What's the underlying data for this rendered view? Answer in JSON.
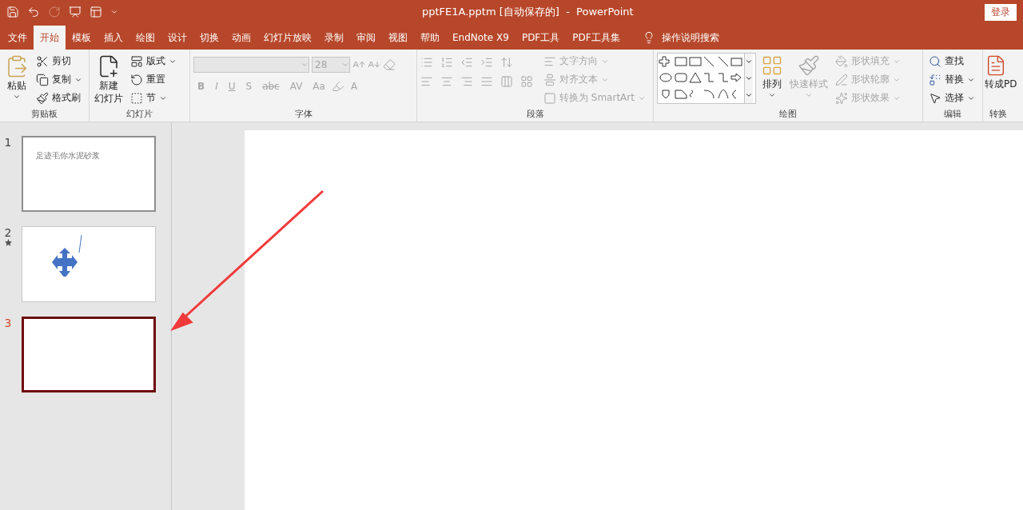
{
  "title_bar": {
    "title": "pptFE1A.pptm [自动保存的]  -  PowerPoint",
    "sign_in": "登录"
  },
  "tabs": [
    {
      "label": "文件",
      "selected": false
    },
    {
      "label": "开始",
      "selected": true
    },
    {
      "label": "模板",
      "selected": false
    },
    {
      "label": "插入",
      "selected": false
    },
    {
      "label": "绘图",
      "selected": false
    },
    {
      "label": "设计",
      "selected": false
    },
    {
      "label": "切换",
      "selected": false
    },
    {
      "label": "动画",
      "selected": false
    },
    {
      "label": "幻灯片放映",
      "selected": false
    },
    {
      "label": "录制",
      "selected": false
    },
    {
      "label": "审阅",
      "selected": false
    },
    {
      "label": "视图",
      "selected": false
    },
    {
      "label": "帮助",
      "selected": false
    },
    {
      "label": "EndNote X9",
      "selected": false
    },
    {
      "label": "PDF工具",
      "selected": false
    },
    {
      "label": "PDF工具集",
      "selected": false
    }
  ],
  "search_hint": "操作说明搜索",
  "ribbon": {
    "clipboard": {
      "label": "剪贴板",
      "paste": "粘贴",
      "items": [
        {
          "label": "剪切",
          "dropdown": false
        },
        {
          "label": "复制",
          "dropdown": true
        },
        {
          "label": "格式刷",
          "dropdown": false
        }
      ]
    },
    "slides": {
      "label": "幻灯片",
      "new_slide": [
        "新建",
        "幻灯片"
      ],
      "items": [
        {
          "label": "版式",
          "dropdown": true
        },
        {
          "label": "重置",
          "dropdown": false
        },
        {
          "label": "节",
          "dropdown": true
        }
      ]
    },
    "font": {
      "label": "字体",
      "font_size": "28",
      "disabled": true,
      "format_buttons": [
        "B",
        "I",
        "U",
        "S",
        "abc",
        "AV",
        "Aa",
        "A"
      ]
    },
    "paragraph": {
      "label": "段落",
      "items": [
        {
          "label": "文字方向",
          "disabled": true
        },
        {
          "label": "对齐文本",
          "disabled": true
        },
        {
          "label": "转换为 SmartArt",
          "disabled": true
        }
      ]
    },
    "drawing": {
      "label": "绘图",
      "arrange": "排列",
      "quick_styles": {
        "label": "快速样式",
        "disabled": true
      },
      "items": [
        {
          "label": "形状填充",
          "disabled": true
        },
        {
          "label": "形状轮廓",
          "disabled": true
        },
        {
          "label": "形状效果",
          "disabled": true
        }
      ]
    },
    "editing": {
      "label": "编辑",
      "items": [
        {
          "label": "查找",
          "dropdown": false
        },
        {
          "label": "替换",
          "dropdown": true
        },
        {
          "label": "选择",
          "dropdown": true
        }
      ]
    },
    "convert": {
      "label": "转换",
      "button": "转成PD"
    }
  },
  "slides": [
    {
      "number": "1",
      "selected": false,
      "animated": false,
      "kind": "text",
      "text": "足迹毛你水泥砂浆"
    },
    {
      "number": "2",
      "selected": false,
      "animated": true,
      "kind": "shape"
    },
    {
      "number": "3",
      "selected": true,
      "animated": false,
      "kind": "blank"
    }
  ]
}
